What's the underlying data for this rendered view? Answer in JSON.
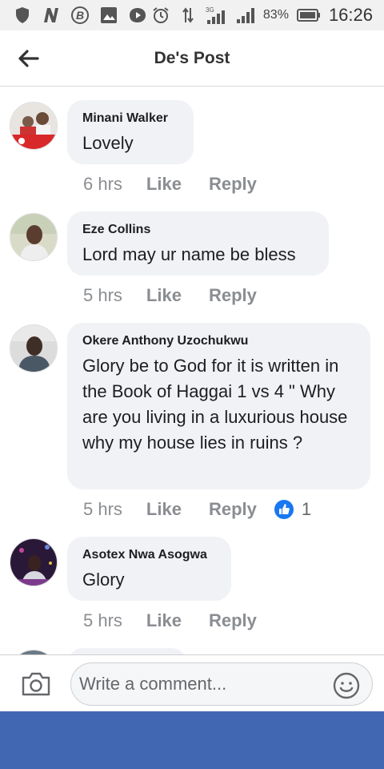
{
  "status_bar": {
    "battery_percent": "83%",
    "time": "16:26",
    "network": "3G"
  },
  "header": {
    "title": "De's Post"
  },
  "comments": [
    {
      "author": "Minani Walker",
      "text": "Lovely",
      "time": "6 hrs",
      "like": "Like",
      "reply": "Reply"
    },
    {
      "author": "Eze Collins",
      "text": "Lord may ur name be bless",
      "time": "5 hrs",
      "like": "Like",
      "reply": "Reply"
    },
    {
      "author": "Okere Anthony Uzochukwu",
      "text": "Glory be to God for it is written in the Book of Haggai 1 vs 4 \" Why are you living in a luxurious house why my house lies in ruins ?",
      "time": "5 hrs",
      "like": "Like",
      "reply": "Reply",
      "reaction_count": "1"
    },
    {
      "author": "Asotex Nwa Asogwa",
      "text": "Glory",
      "time": "5 hrs",
      "like": "Like",
      "reply": "Reply"
    }
  ],
  "composer": {
    "placeholder": "Write a comment..."
  },
  "colors": {
    "brand_blue": "#4267b2",
    "like_blue": "#1877f2",
    "bubble_bg": "#f0f2f5",
    "meta_gray": "#8a8d91"
  }
}
